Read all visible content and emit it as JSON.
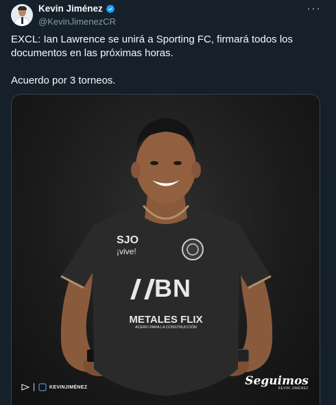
{
  "author": {
    "display_name": "Kevin Jiménez",
    "handle": "@KevinJimenezCR",
    "verified": true
  },
  "more_label": "···",
  "tweet": {
    "paragraphs": [
      "EXCL: Ian Lawrence se unirá a Sporting FC, firmará todos los documentos en las próximas horas.",
      "Acuerdo por 3 torneos."
    ]
  },
  "media": {
    "jersey_sponsor_top": "SJO",
    "jersey_sponsor_top_sub": "¡vive!",
    "jersey_main_sponsor": "BN",
    "jersey_bottom_sponsor": "METALES FLIX",
    "jersey_bottom_sponsor_sub": "ACERO PARA LA CONSTRUCCIÓN",
    "watermark_left": "KEVINJIMÉNEZ",
    "watermark_right": "Seguimos",
    "watermark_right_sub": "KEVIN JIMÉNEZ"
  },
  "colors": {
    "background": "#15202b",
    "text_primary": "#f7f9f9",
    "text_secondary": "#8b98a5",
    "verified": "#1d9bf0",
    "media_border": "#38444d"
  }
}
